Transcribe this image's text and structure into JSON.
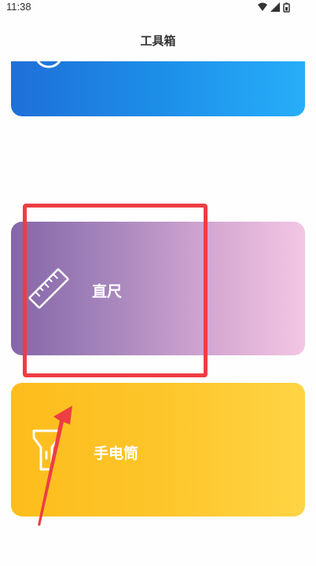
{
  "status_bar": {
    "time": "11:38",
    "icons": [
      "wifi-icon",
      "signal-icon",
      "battery-icon"
    ]
  },
  "app_bar": {
    "title": "工具箱"
  },
  "tools": [
    {
      "label": "",
      "icon": "compass-icon",
      "color": "#1d8ee8"
    },
    {
      "label": "直尺",
      "icon": "ruler-icon",
      "color": "#a887bd"
    },
    {
      "label": "手电筒",
      "icon": "flashlight-icon",
      "color": "#fdc52a"
    }
  ],
  "annotation": {
    "highlight_color": "#ee3d43",
    "arrow_color": "#ee3d43"
  }
}
